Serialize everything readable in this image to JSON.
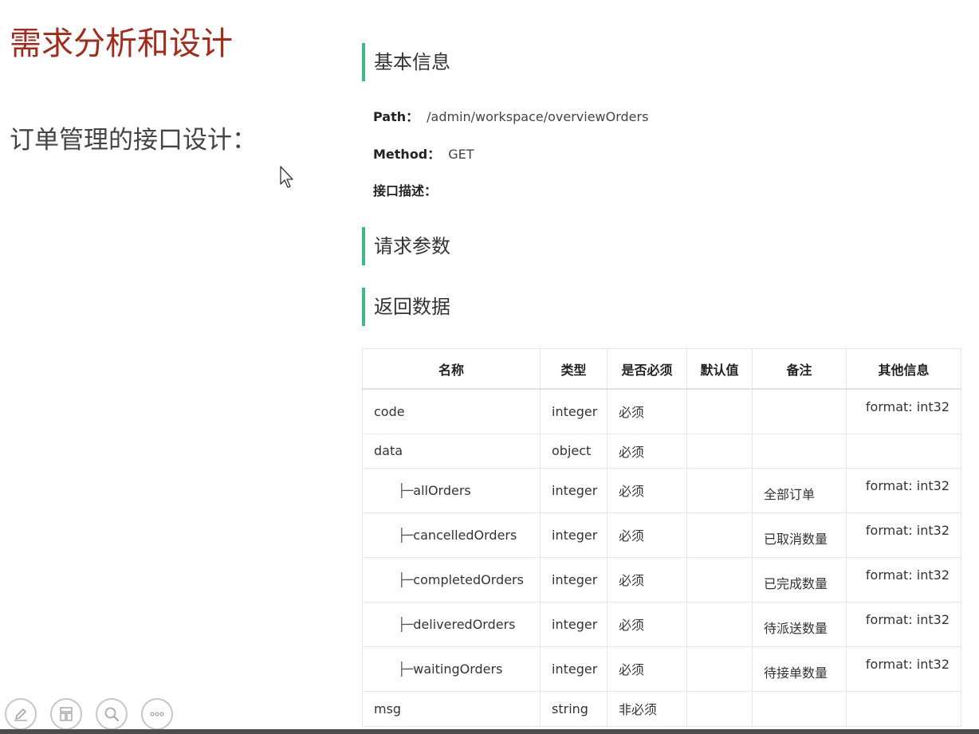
{
  "slide": {
    "title": "需求分析和设计",
    "subtitle": "订单管理的接口设计："
  },
  "api_doc": {
    "basic_info": {
      "heading": "基本信息",
      "path_label": "Path：",
      "path_value": "/admin/workspace/overviewOrders",
      "method_label": "Method：",
      "method_value": "GET",
      "description_label": "接口描述："
    },
    "request_params": {
      "heading": "请求参数"
    },
    "response": {
      "heading": "返回数据",
      "columns": [
        "名称",
        "类型",
        "是否必须",
        "默认值",
        "备注",
        "其他信息"
      ],
      "tree_prefix": "├─",
      "rows": [
        {
          "name": "code",
          "type": "integer",
          "required": "必须",
          "default": "",
          "note": "",
          "other": "format: int32"
        },
        {
          "name": "data",
          "type": "object",
          "required": "必须",
          "default": "",
          "note": "",
          "other": ""
        },
        {
          "name": "allOrders",
          "type": "integer",
          "required": "必须",
          "default": "",
          "note": "全部订单",
          "other": "format: int32"
        },
        {
          "name": "cancelledOrders",
          "type": "integer",
          "required": "必须",
          "default": "",
          "note": "已取消数量",
          "other": "format: int32"
        },
        {
          "name": "completedOrders",
          "type": "integer",
          "required": "必须",
          "default": "",
          "note": "已完成数量",
          "other": "format: int32"
        },
        {
          "name": "deliveredOrders",
          "type": "integer",
          "required": "必须",
          "default": "",
          "note": "待派送数量",
          "other": "format: int32"
        },
        {
          "name": "waitingOrders",
          "type": "integer",
          "required": "必须",
          "default": "",
          "note": "待接单数量",
          "other": "format: int32"
        },
        {
          "name": "msg",
          "type": "string",
          "required": "非必须",
          "default": "",
          "note": "",
          "other": ""
        }
      ]
    }
  },
  "toolbar": {
    "icons": [
      "pen-icon",
      "slides-icon",
      "zoom-icon",
      "more-icon"
    ]
  },
  "colors": {
    "title": "#a52a1a",
    "section_accent": "#42b983",
    "table_border": "#e6e6e6"
  }
}
